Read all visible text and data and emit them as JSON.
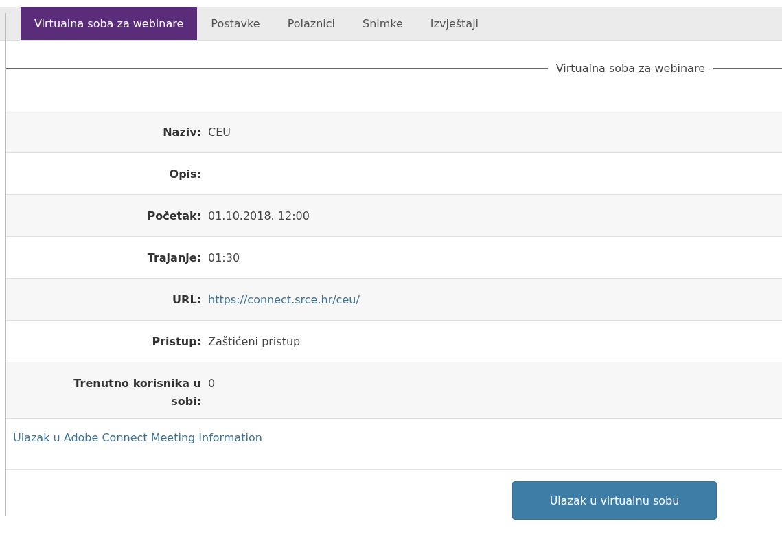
{
  "tabs": [
    {
      "label": "Virtualna soba za webinare",
      "selected": true
    },
    {
      "label": "Postavke",
      "selected": false
    },
    {
      "label": "Polaznici",
      "selected": false
    },
    {
      "label": "Snimke",
      "selected": false
    },
    {
      "label": "Izvještaji",
      "selected": false
    }
  ],
  "section": {
    "legend": "Virtualna soba za webinare"
  },
  "details": [
    {
      "label": "Naziv:",
      "value": "CEU",
      "kind": "text"
    },
    {
      "label": "Opis:"
    },
    {
      "label": "Početak:",
      "value": "01.10.2018. 12:00",
      "kind": "text"
    },
    {
      "label": "Trajanje:",
      "value": "01:30",
      "kind": "text"
    },
    {
      "label": "URL:",
      "value": "https://connect.srce.hr/ceu/",
      "kind": "link"
    },
    {
      "label": "Pristup:",
      "value": "Zaštićeni pristup",
      "kind": "text"
    },
    {
      "label": "Trenutno korisnika u sobi:",
      "value": "0",
      "kind": "text"
    }
  ],
  "info_link": "Ulazak u Adobe Connect Meeting Information",
  "enter_button": "Ulazak u virtualnu sobu"
}
